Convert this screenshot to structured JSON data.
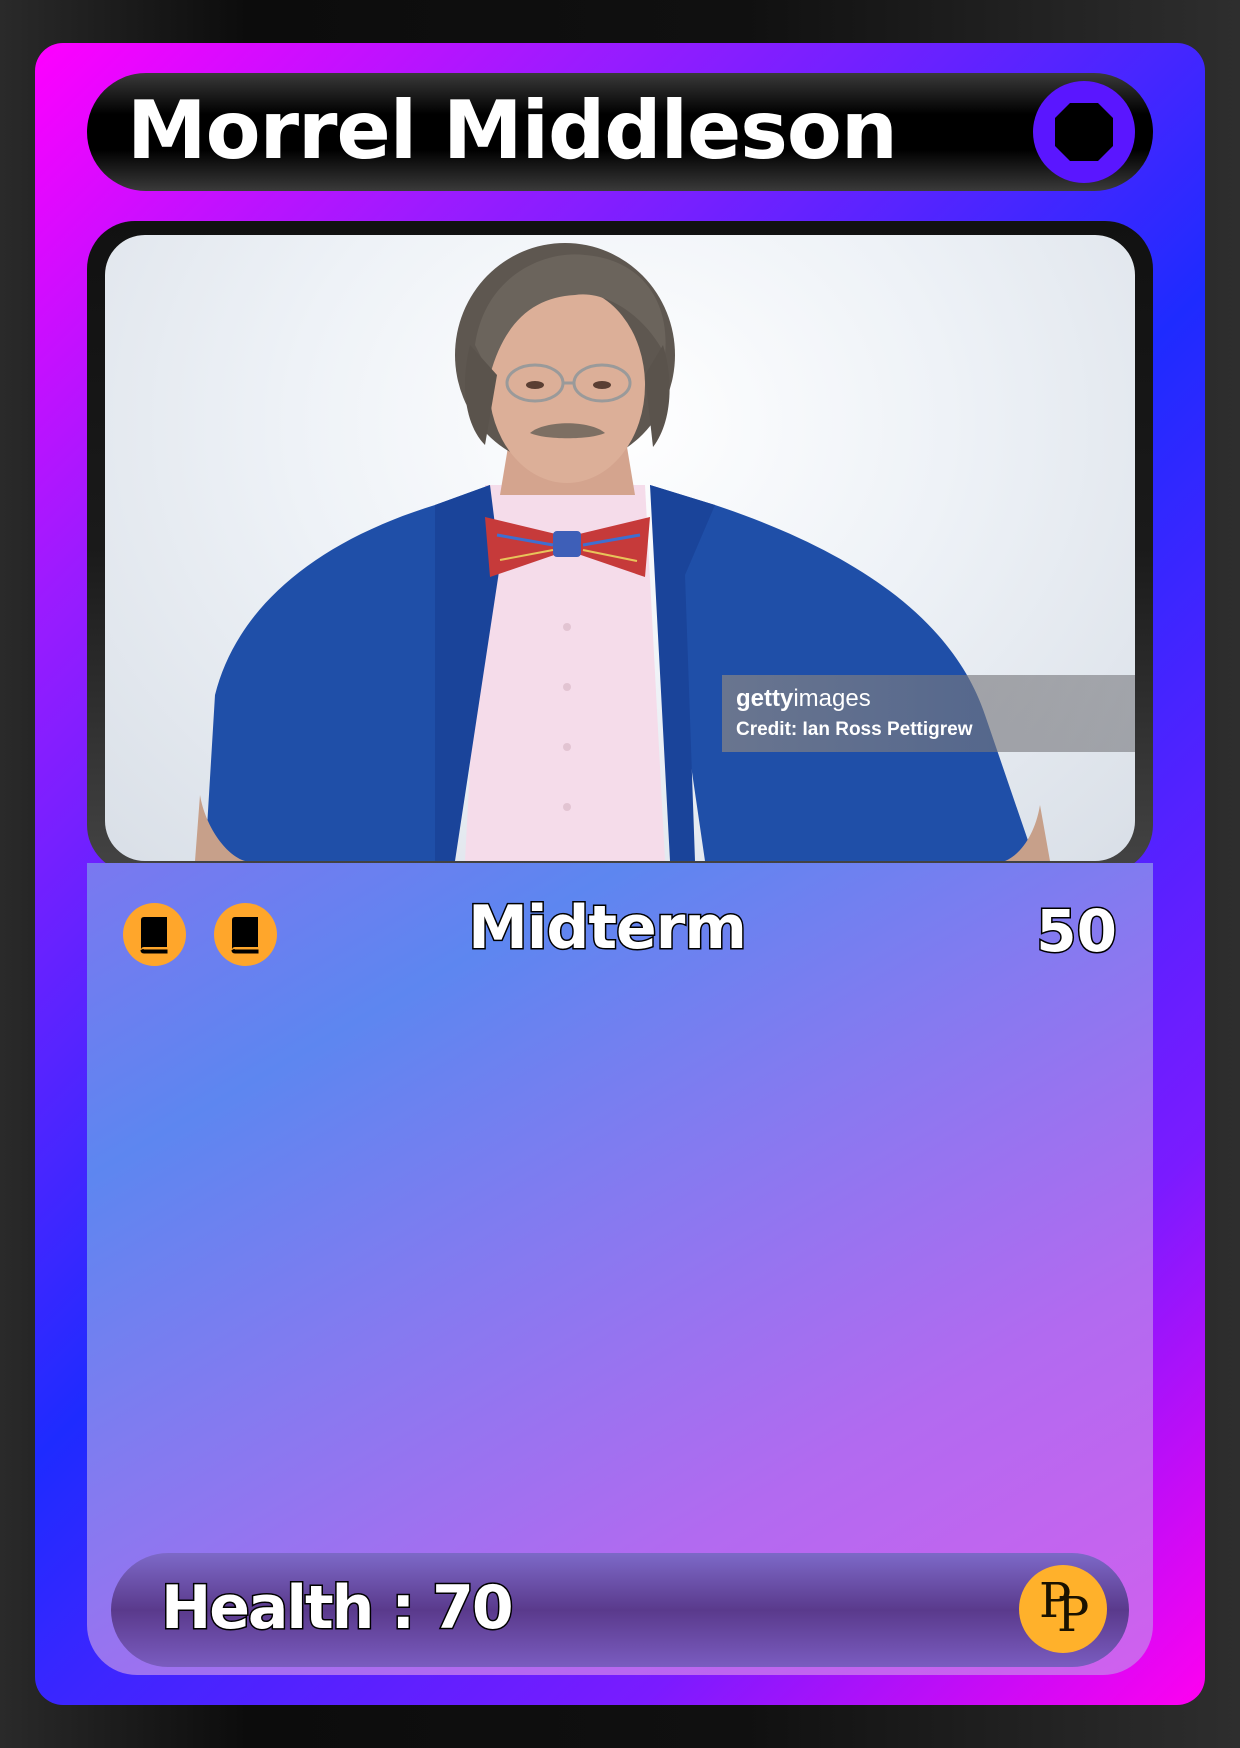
{
  "card": {
    "name": "Morrel Middleson",
    "type": "Midterm",
    "attack": "50",
    "health_label": "Health : 70",
    "cost_icons": [
      "book-icon",
      "book-icon"
    ],
    "energy_icon": "octagon-icon",
    "logo_text": [
      "P",
      "P"
    ]
  },
  "photo": {
    "watermark_brand_bold": "getty",
    "watermark_brand_light": "images",
    "watermark_credit": "Credit: Ian Ross Pettigrew"
  },
  "colors": {
    "frame_magenta": "#ff00ff",
    "frame_blue": "#1e2bff",
    "cost_orange": "#ffa62b",
    "energy_purple": "#5a16ff",
    "logo_gold": "#ffb12b"
  }
}
